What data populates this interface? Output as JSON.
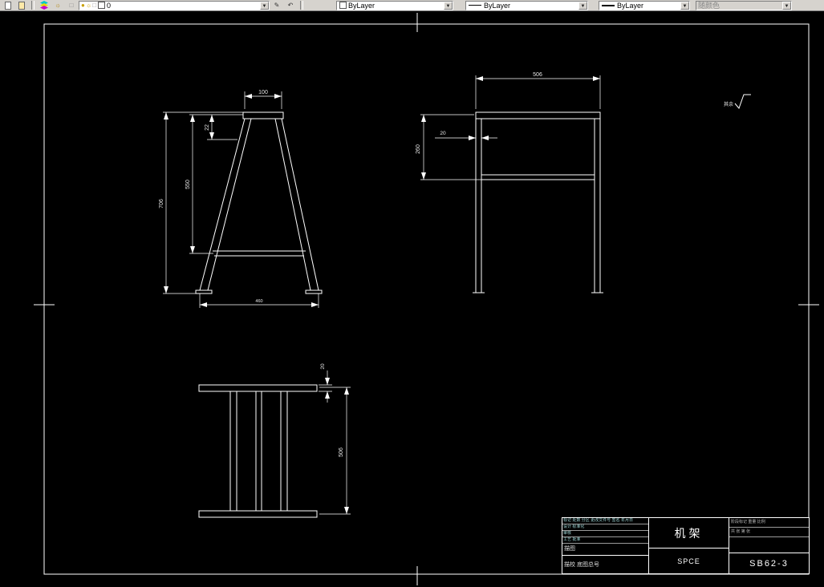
{
  "toolbar": {
    "layer_combo": {
      "value": "0"
    },
    "color_combo": {
      "value": "ByLayer"
    },
    "linetype_combo": {
      "value": "ByLayer"
    },
    "lineweight_combo": {
      "value": "ByLayer"
    },
    "plotstyle_combo": {
      "value": "随颜色"
    },
    "arrow_glyph": "▼"
  },
  "colors": {
    "background": "#000000",
    "line": "#ffffff",
    "toolbar_bg": "#d6d3ce"
  },
  "drawing": {
    "front_view": {
      "dim_top_width": "100",
      "dim_offset": "22",
      "dim_mid_height": "550",
      "dim_total_height": "706",
      "dim_bottom_width": "460"
    },
    "side_view": {
      "dim_width": "506",
      "dim_height": "260",
      "dim_thickness": "20"
    },
    "top_view": {
      "dim_thickness": "20",
      "dim_depth": "506"
    },
    "roughness_note": "其余",
    "title_block": {
      "part_name": "机架",
      "material": "SPCE",
      "drawing_number": "SB62-3",
      "left_row_1": "标记 处数 分区 更改文件号 签名 年月日",
      "left_row_2": "设计 标准化",
      "left_row_3": "审核",
      "left_row_4": "工艺 批准",
      "left_bottom_1": "描图",
      "left_bottom_2": "描校 底图总号",
      "right_row_1": "阶段标记 重量 比例",
      "right_row_2": "共 张 第 张"
    }
  }
}
